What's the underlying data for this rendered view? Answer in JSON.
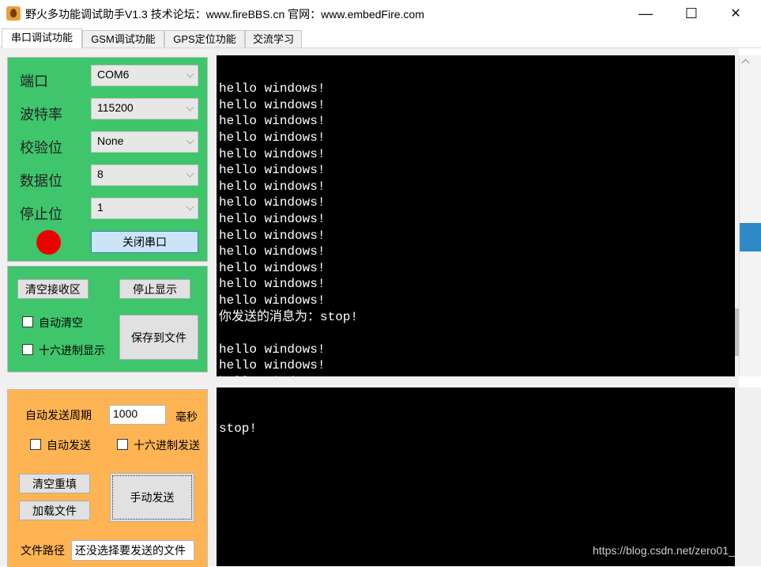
{
  "window": {
    "title": "野火多功能调试助手V1.3    技术论坛：www.fireBBS.cn  官网：www.embedFire.com",
    "minimize": "—",
    "maximize": "☐",
    "close": "✕"
  },
  "tabs": [
    {
      "label": "串口调试功能"
    },
    {
      "label": "GSM调试功能"
    },
    {
      "label": "GPS定位功能"
    },
    {
      "label": "交流学习"
    }
  ],
  "serial": {
    "port_label": "端口",
    "port_value": "COM6",
    "baud_label": "波特率",
    "baud_value": "115200",
    "parity_label": "校验位",
    "parity_value": "None",
    "databits_label": "数据位",
    "databits_value": "8",
    "stopbits_label": "停止位",
    "stopbits_value": "1",
    "status_color": "#ee0000",
    "close_port_button": "关闭串口"
  },
  "receive": {
    "clear_button": "清空接收区",
    "stop_display_button": "停止显示",
    "auto_clear_label": "自动清空",
    "hex_display_label": "十六进制显示",
    "save_to_file_button": "保存到文件"
  },
  "send": {
    "period_label": "自动发送周期",
    "period_value": "1000",
    "period_unit": "毫秒",
    "auto_send_label": "自动发送",
    "hex_send_label": "十六进制发送",
    "clear_refill_button": "清空重填",
    "load_file_button": "加载文件",
    "manual_send_button": "手动发送",
    "file_path_label": "文件路径",
    "file_path_value": "还没选择要发送的文件"
  },
  "receive_text": "hello windows!\nhello windows!\nhello windows!\nhello windows!\nhello windows!\nhello windows!\nhello windows!\nhello windows!\nhello windows!\nhello windows!\nhello windows!\nhello windows!\nhello windows!\nhello windows!\n你发送的消息为：stop!\n\nhello windows!\nhello windows!\nhello windows!",
  "send_text": "stop!",
  "watermark": "https://blog.csdn.net/zero01_"
}
